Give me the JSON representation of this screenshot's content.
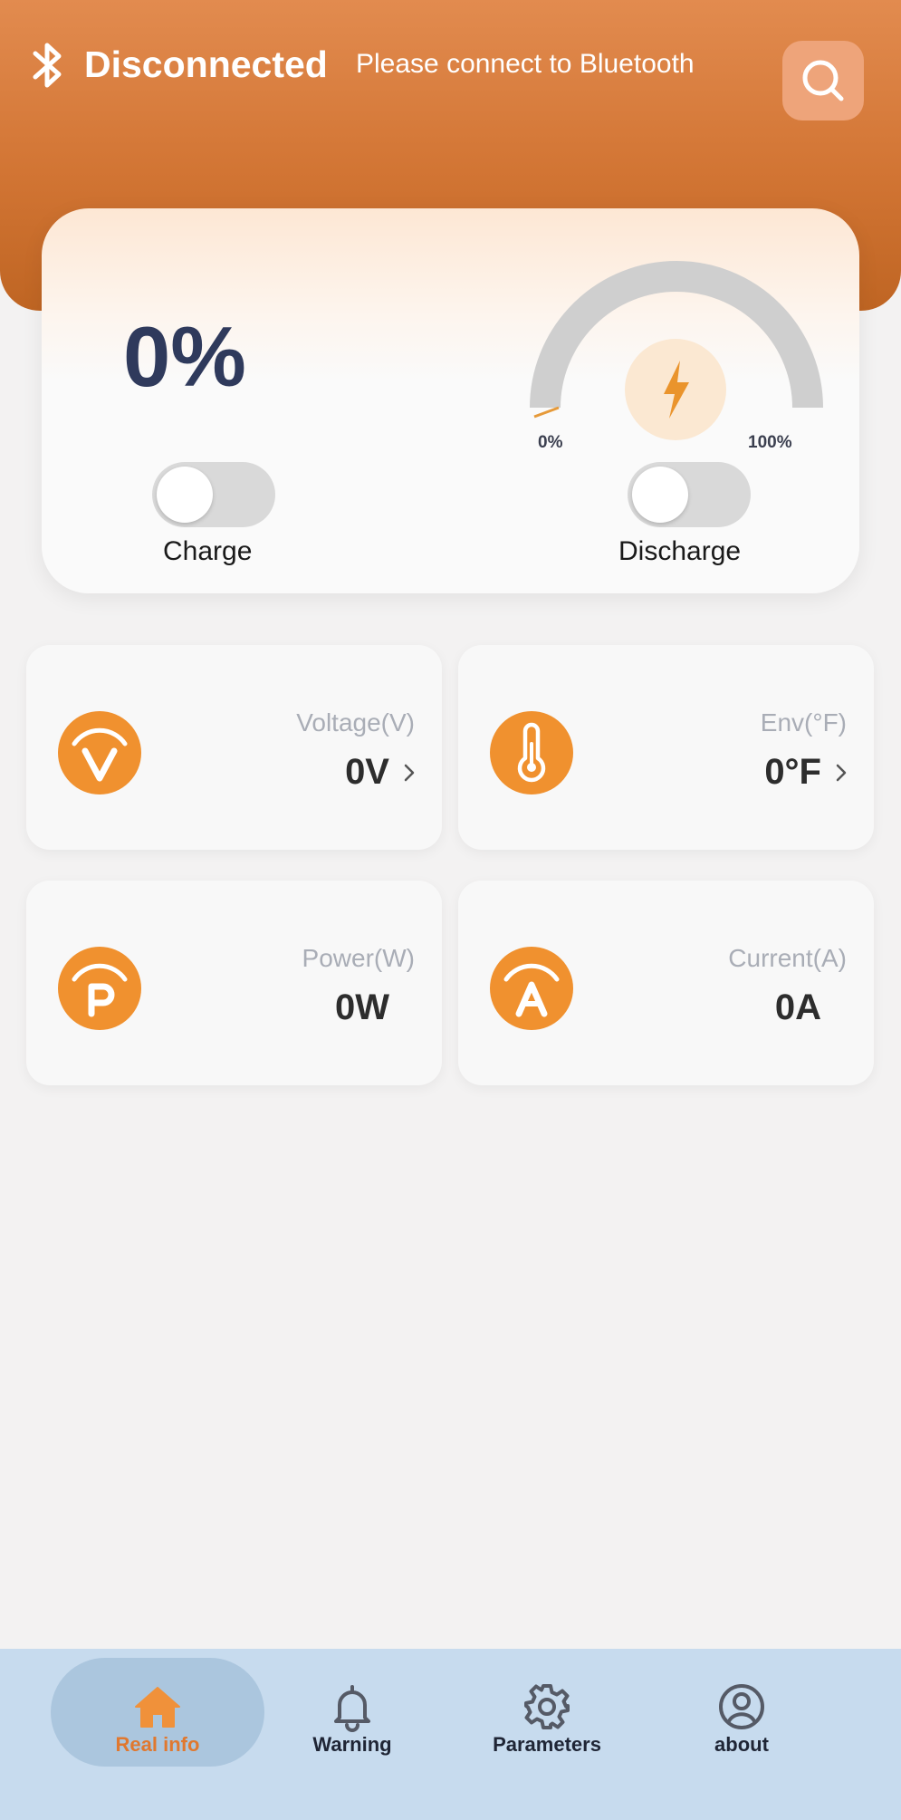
{
  "header": {
    "status_title": "Disconnected",
    "status_subtitle": "Please connect to Bluetooth",
    "bluetooth_icon": "bluetooth-icon",
    "search_icon": "search-icon"
  },
  "battery": {
    "percent_text": "0%",
    "gauge_min_label": "0%",
    "gauge_max_label": "100%",
    "gauge_level": 0,
    "charge_label": "Charge",
    "charge_on": false,
    "discharge_label": "Discharge",
    "discharge_on": false
  },
  "stats": [
    {
      "label": "Voltage(V)",
      "value": "0V",
      "icon": "voltage-icon",
      "has_chevron": true
    },
    {
      "label": "Env(°F)",
      "value": "0°F",
      "icon": "thermometer-icon",
      "has_chevron": true
    },
    {
      "label": "Power(W)",
      "value": "0W",
      "icon": "power-icon",
      "has_chevron": false
    },
    {
      "label": "Current(A)",
      "value": "0A",
      "icon": "current-icon",
      "has_chevron": false
    }
  ],
  "tabs": [
    {
      "label": "Real info",
      "icon": "home-icon",
      "active": true
    },
    {
      "label": "Warning",
      "icon": "bell-icon",
      "active": false
    },
    {
      "label": "Parameters",
      "icon": "gear-icon",
      "active": false
    },
    {
      "label": "about",
      "icon": "user-circle-icon",
      "active": false
    }
  ],
  "colors": {
    "accent": "#e0782f",
    "header": "#d27534",
    "icon_orange": "#f0912f",
    "tabbar": "#c7dbee"
  }
}
